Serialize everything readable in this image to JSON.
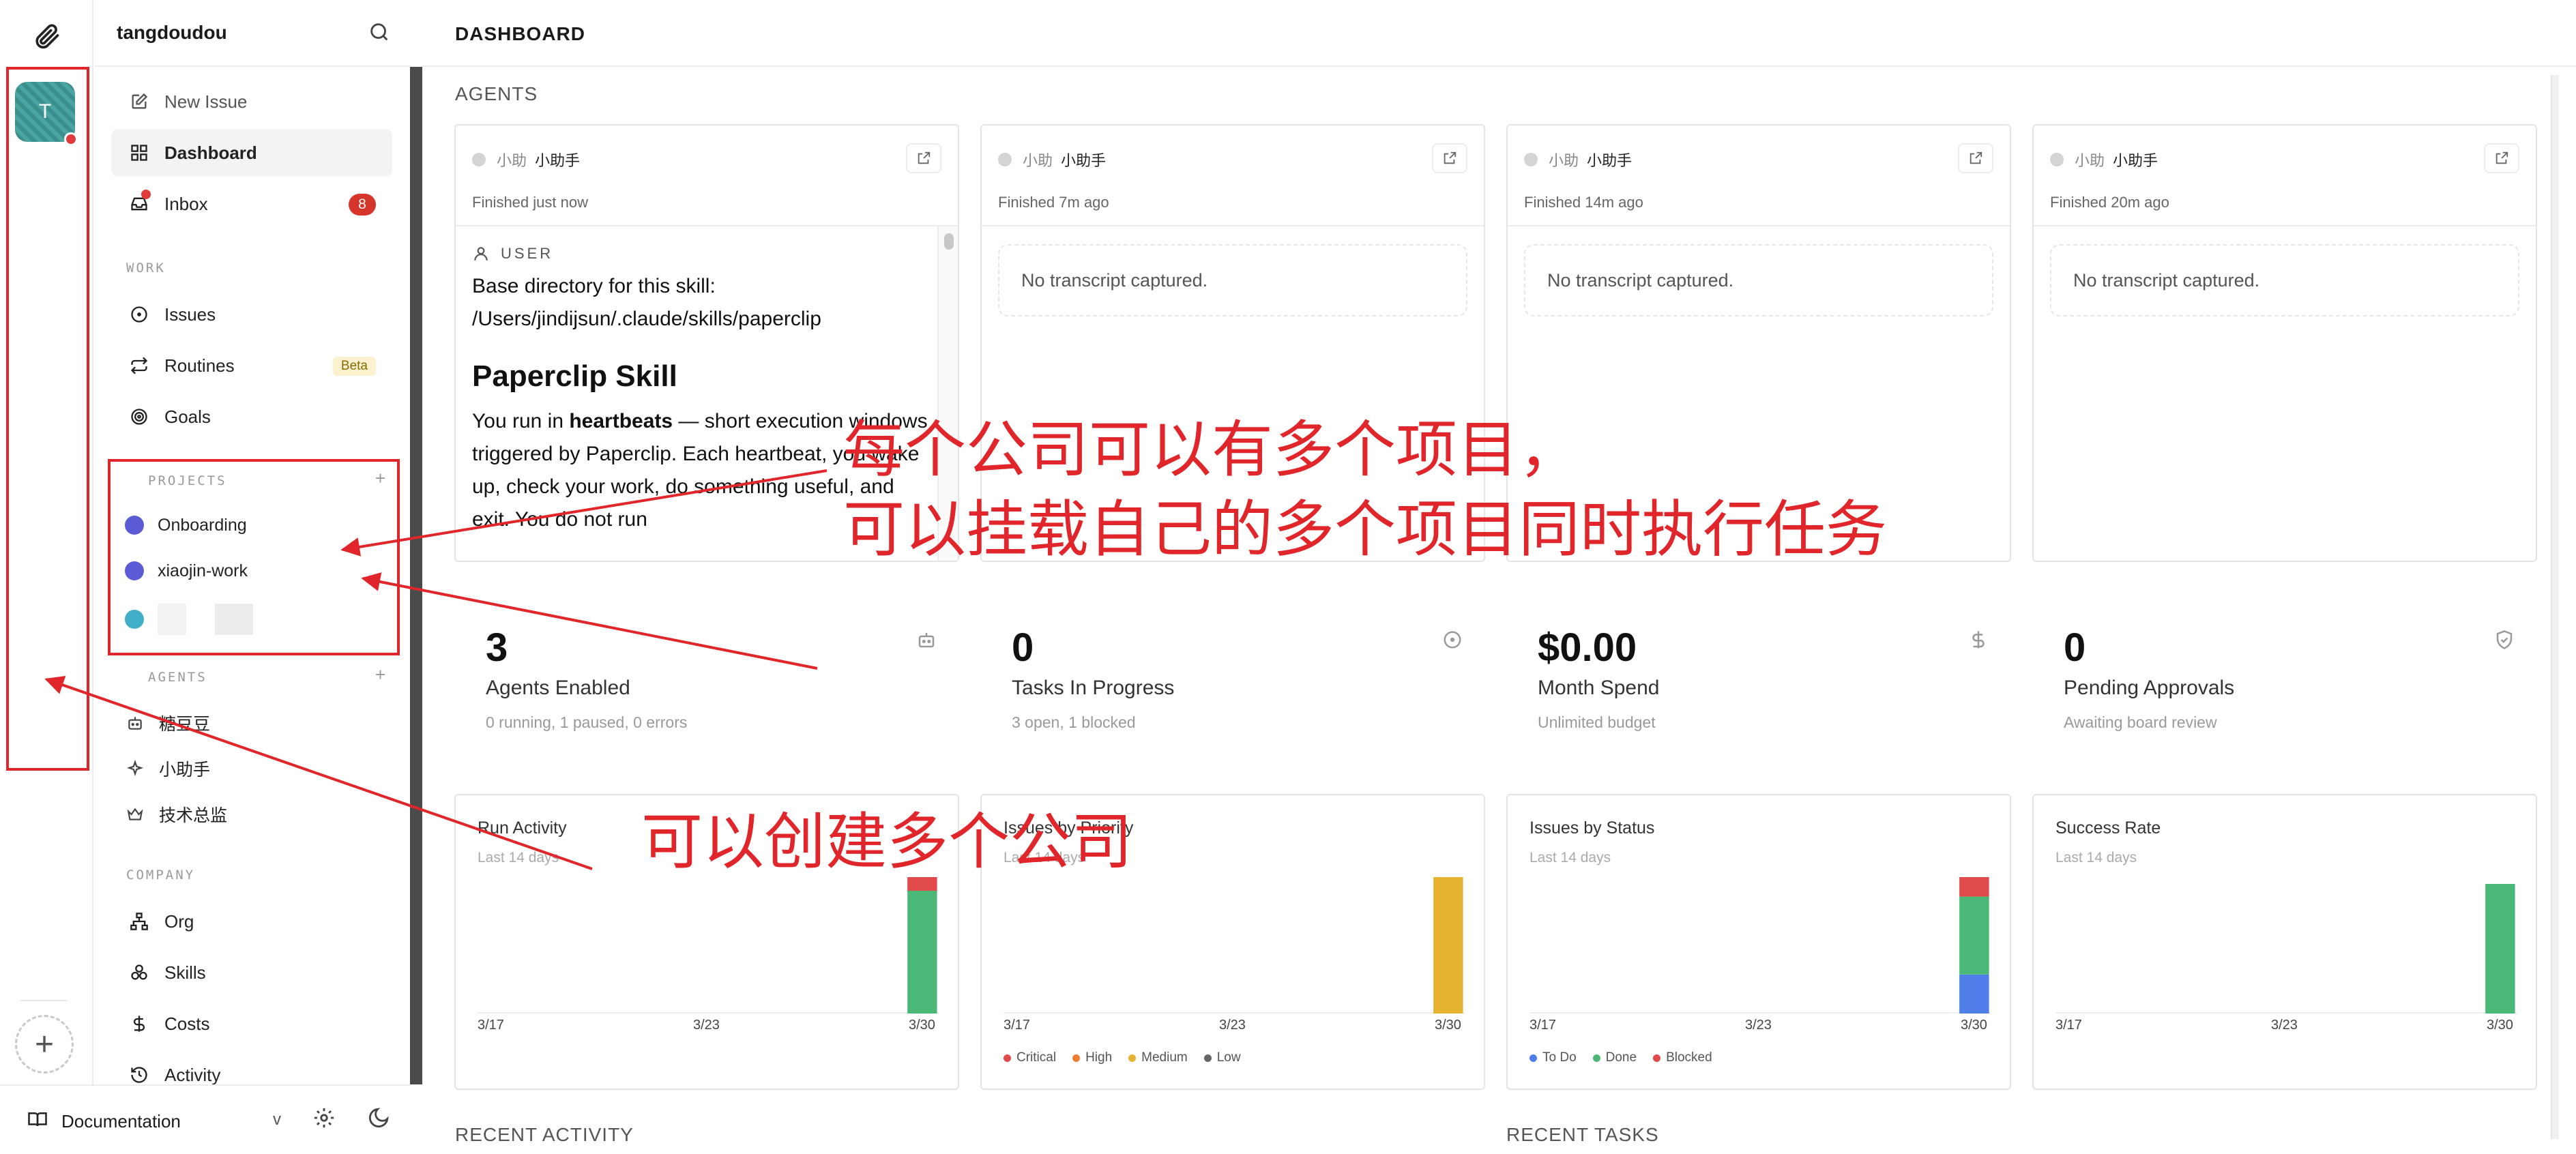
{
  "rail": {
    "company_initial": "T"
  },
  "sidebar": {
    "company_name": "tangdoudou",
    "nav_top": [
      {
        "label": "New Issue",
        "icon": "pencil-square-icon"
      },
      {
        "label": "Dashboard",
        "icon": "grid-icon"
      },
      {
        "label": "Inbox",
        "icon": "inbox-icon",
        "badge": "8"
      }
    ],
    "work_label": "WORK",
    "work_items": [
      {
        "label": "Issues",
        "icon": "circle-dot-icon"
      },
      {
        "label": "Routines",
        "icon": "repeat-icon",
        "tag": "Beta"
      },
      {
        "label": "Goals",
        "icon": "target-icon"
      }
    ],
    "projects_label": "PROJECTS",
    "projects": [
      {
        "label": "Onboarding",
        "color": "#5b5bd6"
      },
      {
        "label": "xiaojin-work",
        "color": "#5b5bd6"
      },
      {
        "label": "",
        "color": "#3fb0c8"
      }
    ],
    "agents_label": "AGENTS",
    "agents": [
      {
        "label": "糖豆豆",
        "icon": "robot-icon"
      },
      {
        "label": "小助手",
        "icon": "sparkle-icon"
      },
      {
        "label": "技术总监",
        "icon": "crown-icon"
      }
    ],
    "company_label": "COMPANY",
    "company_items": [
      {
        "label": "Org",
        "icon": "org-chart-icon"
      },
      {
        "label": "Skills",
        "icon": "boxes-icon"
      },
      {
        "label": "Costs",
        "icon": "dollar-icon"
      },
      {
        "label": "Activity",
        "icon": "history-icon"
      }
    ],
    "documentation": "Documentation",
    "version": "v"
  },
  "main": {
    "title": "DASHBOARD",
    "agents_section": "AGENTS",
    "agent_cards": [
      {
        "agent_short": "小助",
        "agent_name": "小助手",
        "finished": "Finished just now",
        "has_transcript": true
      },
      {
        "agent_short": "小助",
        "agent_name": "小助手",
        "finished": "Finished 7m ago",
        "empty": "No transcript captured."
      },
      {
        "agent_short": "小助",
        "agent_name": "小助手",
        "finished": "Finished 14m ago",
        "empty": "No transcript captured."
      },
      {
        "agent_short": "小助",
        "agent_name": "小助手",
        "finished": "Finished 20m ago",
        "empty": "No transcript captured."
      }
    ],
    "transcript": {
      "user_label": "USER",
      "line1": "Base directory for this skill:",
      "line2": "/Users/jindijsun/.claude/skills/paperclip",
      "heading": "Paperclip Skill",
      "para_pre": "You run in ",
      "para_bold": "heartbeats",
      "para_post": " — short execution windows triggered by Paperclip. Each heartbeat, you wake up, check your work, do something useful, and exit. You do not run"
    },
    "stats": [
      {
        "value": "3",
        "label": "Agents Enabled",
        "sub": "0 running, 1 paused, 0 errors",
        "icon": "robot-icon"
      },
      {
        "value": "0",
        "label": "Tasks In Progress",
        "sub": "3 open, 1 blocked",
        "icon": "circle-dot-icon"
      },
      {
        "value": "$0.00",
        "label": "Month Spend",
        "sub": "Unlimited budget",
        "icon": "dollar-icon"
      },
      {
        "value": "0",
        "label": "Pending Approvals",
        "sub": "Awaiting board review",
        "icon": "shield-check-icon"
      }
    ],
    "recent_activity": "RECENT ACTIVITY",
    "recent_tasks": "RECENT TASKS"
  },
  "chart_data": [
    {
      "type": "bar",
      "title": "Run Activity",
      "subtitle": "Last 14 days",
      "x_ticks": [
        "3/17",
        "3/23",
        "3/30"
      ],
      "series": [
        {
          "color": "#4cb878",
          "values": [
            0,
            0,
            0,
            0,
            0,
            0,
            0,
            0,
            0,
            0,
            0,
            0,
            0,
            9
          ]
        },
        {
          "color": "#e04a4a",
          "values": [
            0,
            0,
            0,
            0,
            0,
            0,
            0,
            0,
            0,
            0,
            0,
            0,
            0,
            1
          ]
        }
      ],
      "ylim": [
        0,
        10
      ]
    },
    {
      "type": "bar",
      "title": "Issues by Priority",
      "subtitle": "Last 14 days",
      "x_ticks": [
        "3/17",
        "3/23",
        "3/30"
      ],
      "legend": [
        "Critical",
        "High",
        "Medium",
        "Low"
      ],
      "legend_colors": [
        "#e04a4a",
        "#ef7d2f",
        "#e6b331",
        "#666666"
      ],
      "series": [
        {
          "name": "Critical",
          "color": "#e04a4a",
          "values": [
            0,
            0,
            0,
            0,
            0,
            0,
            0,
            0,
            0,
            0,
            0,
            0,
            0,
            0
          ]
        },
        {
          "name": "High",
          "color": "#ef7d2f",
          "values": [
            0,
            0,
            0,
            0,
            0,
            0,
            0,
            0,
            0,
            0,
            0,
            0,
            0,
            0
          ]
        },
        {
          "name": "Medium",
          "color": "#e6b331",
          "values": [
            0,
            0,
            0,
            0,
            0,
            0,
            0,
            0,
            0,
            0,
            0,
            0,
            0,
            4
          ]
        },
        {
          "name": "Low",
          "color": "#666666",
          "values": [
            0,
            0,
            0,
            0,
            0,
            0,
            0,
            0,
            0,
            0,
            0,
            0,
            0,
            0
          ]
        }
      ],
      "ylim": [
        0,
        4
      ]
    },
    {
      "type": "bar",
      "title": "Issues by Status",
      "subtitle": "Last 14 days",
      "x_ticks": [
        "3/17",
        "3/23",
        "3/30"
      ],
      "legend": [
        "To Do",
        "Done",
        "Blocked"
      ],
      "legend_colors": [
        "#4f7ee8",
        "#4cb878",
        "#e04a4a"
      ],
      "series": [
        {
          "name": "To Do",
          "color": "#4f7ee8",
          "values": [
            0,
            0,
            0,
            0,
            0,
            0,
            0,
            0,
            0,
            0,
            0,
            0,
            0,
            1
          ]
        },
        {
          "name": "Done",
          "color": "#4cb878",
          "values": [
            0,
            0,
            0,
            0,
            0,
            0,
            0,
            0,
            0,
            0,
            0,
            0,
            0,
            2
          ]
        },
        {
          "name": "Blocked",
          "color": "#e04a4a",
          "values": [
            0,
            0,
            0,
            0,
            0,
            0,
            0,
            0,
            0,
            0,
            0,
            0,
            0,
            0.5
          ]
        }
      ],
      "ylim": [
        0,
        3.5
      ]
    },
    {
      "type": "bar",
      "title": "Success Rate",
      "subtitle": "Last 14 days",
      "x_ticks": [
        "3/17",
        "3/23",
        "3/30"
      ],
      "series": [
        {
          "color": "#4cb878",
          "values": [
            0,
            0,
            0,
            0,
            0,
            0,
            0,
            0,
            0,
            0,
            0,
            0,
            0,
            95
          ]
        }
      ],
      "ylim": [
        0,
        100
      ]
    }
  ],
  "annotations": {
    "projects_note_line1": "每个公司可以有多个项目，",
    "projects_note_line2": "可以挂载自己的多个项目同时执行任务",
    "company_note": "可以创建多个公司",
    "color": "#e0262a"
  }
}
